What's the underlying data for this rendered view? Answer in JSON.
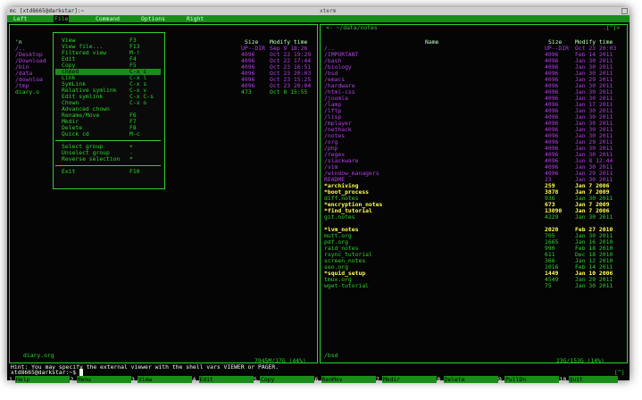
{
  "window": {
    "title_left": "mc [xtd8665@darkstar]:~",
    "title_right": "xterm"
  },
  "menubar": {
    "items": [
      "Left",
      "File",
      "Command",
      "Options",
      "Right"
    ],
    "selected": "File"
  },
  "file_menu": {
    "items": [
      {
        "label": "View",
        "key": "F3"
      },
      {
        "label": "View file...",
        "key": "F13"
      },
      {
        "label": "Filtered view",
        "key": "M-!"
      },
      {
        "label": "Edit",
        "key": "F4"
      },
      {
        "label": "Copy",
        "key": "F5"
      },
      {
        "label": "chmod",
        "key": "C-x c",
        "selected": true
      },
      {
        "label": "Link",
        "key": "C-x l"
      },
      {
        "label": "SymLink",
        "key": "C-x s"
      },
      {
        "label": "Relative symlink",
        "key": "C-x v"
      },
      {
        "label": "Edit symlink",
        "key": "C-x C-s"
      },
      {
        "label": "Chown",
        "key": "C-x o"
      },
      {
        "label": "Advanced chown",
        "key": ""
      },
      {
        "label": "Rename/Move",
        "key": "F6"
      },
      {
        "label": "Mkdir",
        "key": "F7"
      },
      {
        "label": "Delete",
        "key": "F8"
      },
      {
        "label": "Quick cd",
        "key": "M-c"
      }
    ],
    "group_items": [
      {
        "label": "Select group",
        "key": "+"
      },
      {
        "label": "Unselect group",
        "key": "-"
      },
      {
        "label": "Reverse selection",
        "key": "*"
      }
    ],
    "exit": {
      "label": "Exit",
      "key": "F10"
    }
  },
  "left_panel": {
    "hdr_name": "'n",
    "hdr_size": "Size",
    "hdr_mtime": "Modify time",
    "rows": [
      {
        "name": "/..",
        "size": "UP--DIR",
        "mtime": "Sep  9 18:26"
      },
      {
        "name": "/Desktop",
        "size": "4096",
        "mtime": "Oct 22 19:29"
      },
      {
        "name": "/Download",
        "size": "4096",
        "mtime": "Oct 22 17:44"
      },
      {
        "name": "/bin",
        "size": "4096",
        "mtime": "Oct 23 16:51"
      },
      {
        "name": "/data",
        "size": "4096",
        "mtime": "Oct 23 20:03"
      },
      {
        "name": "/downloa",
        "size": "4096",
        "mtime": "Oct 23 15:25"
      },
      {
        "name": "/tmp",
        "size": "4096",
        "mtime": "Oct 23 20:04"
      },
      {
        "name": "diary.o",
        "size": "473",
        "mtime": "Oct  8 15:55"
      }
    ],
    "footer_file": "diary.org",
    "footer_disk": "7945M/17G (44%)"
  },
  "right_panel": {
    "path": "<- ~/data/notes",
    "bracket": ".[^]>",
    "hdr_name": "Name",
    "hdr_size": "Size",
    "hdr_mtime": "Modify time",
    "rows": [
      {
        "name": "/..",
        "size": "UP--DIR",
        "mtime": "Oct 23 20:03",
        "color": "purple"
      },
      {
        "name": "/IMPORTANT",
        "size": "4096",
        "mtime": "Feb 14 2011",
        "color": "purple"
      },
      {
        "name": "/bash",
        "size": "4096",
        "mtime": "Jan 30 2011",
        "color": "purple"
      },
      {
        "name": "/biology",
        "size": "4096",
        "mtime": "Jan 30 2011",
        "color": "purple"
      },
      {
        "name": "/bsd",
        "size": "4096",
        "mtime": "Jan 30 2011",
        "color": "purple"
      },
      {
        "name": "/emacs",
        "size": "4096",
        "mtime": "Jan 29 2011",
        "color": "purple"
      },
      {
        "name": "/hardware",
        "size": "4096",
        "mtime": "Jan 30 2011",
        "color": "purple"
      },
      {
        "name": "/html-css",
        "size": "4096",
        "mtime": "Jan 30 2011",
        "color": "purple"
      },
      {
        "name": "/joomla",
        "size": "4096",
        "mtime": "Jan 30 2011",
        "color": "purple"
      },
      {
        "name": "/lamp",
        "size": "4096",
        "mtime": "Jan 17 2011",
        "color": "purple"
      },
      {
        "name": "/lftp",
        "size": "4096",
        "mtime": "Jan 30 2011",
        "color": "purple"
      },
      {
        "name": "/lisp",
        "size": "4096",
        "mtime": "Jan 30 2011",
        "color": "purple"
      },
      {
        "name": "/mplayer",
        "size": "4096",
        "mtime": "Jan 30 2011",
        "color": "purple"
      },
      {
        "name": "/nethack",
        "size": "4096",
        "mtime": "Jan 30 2011",
        "color": "purple"
      },
      {
        "name": "/notes",
        "size": "4096",
        "mtime": "Jan 30 2011",
        "color": "purple"
      },
      {
        "name": "/org",
        "size": "4096",
        "mtime": "Jan 29 2011",
        "color": "purple"
      },
      {
        "name": "/php",
        "size": "4096",
        "mtime": "Jan 30 2011",
        "color": "purple"
      },
      {
        "name": "/regex",
        "size": "4096",
        "mtime": "Jan 30 2011",
        "color": "purple"
      },
      {
        "name": "/slackware",
        "size": "4096",
        "mtime": "Jun  8 12:44",
        "color": "purple"
      },
      {
        "name": "/vim",
        "size": "4096",
        "mtime": "Jan 30 2011",
        "color": "purple"
      },
      {
        "name": "/window_managers",
        "size": "4096",
        "mtime": "Jan 29 2011",
        "color": "purple"
      },
      {
        "name": " README",
        "size": "23",
        "mtime": "Jan 30 2011",
        "color": "purple"
      },
      {
        "name": "*archiving",
        "size": "259",
        "mtime": "Jan  7 2006",
        "color": "yellow"
      },
      {
        "name": "*boot_process",
        "size": "3878",
        "mtime": "Jan  7 2009",
        "color": "yellow"
      },
      {
        "name": " diff.notes",
        "size": "936",
        "mtime": "Jan 30 2011",
        "color": "green"
      },
      {
        "name": "*encryption_notes",
        "size": "673",
        "mtime": "Jan  7 2009",
        "color": "yellow"
      },
      {
        "name": "*find_tutorial",
        "size": "13090",
        "mtime": "Jan  7 2006",
        "color": "yellow"
      },
      {
        "name": " git.notes",
        "size": "4229",
        "mtime": "Jan 30 2011",
        "color": "green"
      },
      {
        "name": "",
        "size": "",
        "mtime": "",
        "color": "green"
      },
      {
        "name": "*lvm_notes",
        "size": "2020",
        "mtime": "Feb 27 2010",
        "color": "yellow"
      },
      {
        "name": " mutt.org",
        "size": "705",
        "mtime": "Jan 30 2011",
        "color": "green"
      },
      {
        "name": " pdf.org",
        "size": "1665",
        "mtime": "Jan 16 2010",
        "color": "green"
      },
      {
        "name": " raid_notes",
        "size": "990",
        "mtime": "Feb 18 2010",
        "color": "green"
      },
      {
        "name": " rsync_tutorial",
        "size": "611",
        "mtime": "Dec 18 2010",
        "color": "green"
      },
      {
        "name": " screen_notes",
        "size": "366",
        "mtime": "Jan 12 2010",
        "color": "green"
      },
      {
        "name": " seo.org",
        "size": "1016",
        "mtime": "Feb 14 2011",
        "color": "green"
      },
      {
        "name": "*squid_setup",
        "size": "1449",
        "mtime": "Jan 10 2006",
        "color": "yellow"
      },
      {
        "name": " tmux.org",
        "size": "4549",
        "mtime": "Jan 29 2011",
        "color": "green"
      },
      {
        "name": " wget-tutorial",
        "size": "75",
        "mtime": "Jan 30 2011",
        "color": "green"
      }
    ],
    "footer_file": "/bsd",
    "footer_disk": "23G/153G (14%)"
  },
  "hint": "Hint: You may specify the external viewer with the shell vars VIEWER or PAGER.",
  "prompt": "xtd8665@darkstar:~$",
  "prompt_right": "[^]",
  "fkeys": [
    {
      "n": "1",
      "label": "Help"
    },
    {
      "n": "2",
      "label": "Menu"
    },
    {
      "n": "3",
      "label": "View"
    },
    {
      "n": "4",
      "label": "Edit"
    },
    {
      "n": "5",
      "label": "Copy"
    },
    {
      "n": "6",
      "label": "RenMov"
    },
    {
      "n": "7",
      "label": "Mkdir"
    },
    {
      "n": "8",
      "label": "Delete"
    },
    {
      "n": "9",
      "label": "PullDn"
    },
    {
      "n": "10",
      "label": "Quit"
    }
  ]
}
